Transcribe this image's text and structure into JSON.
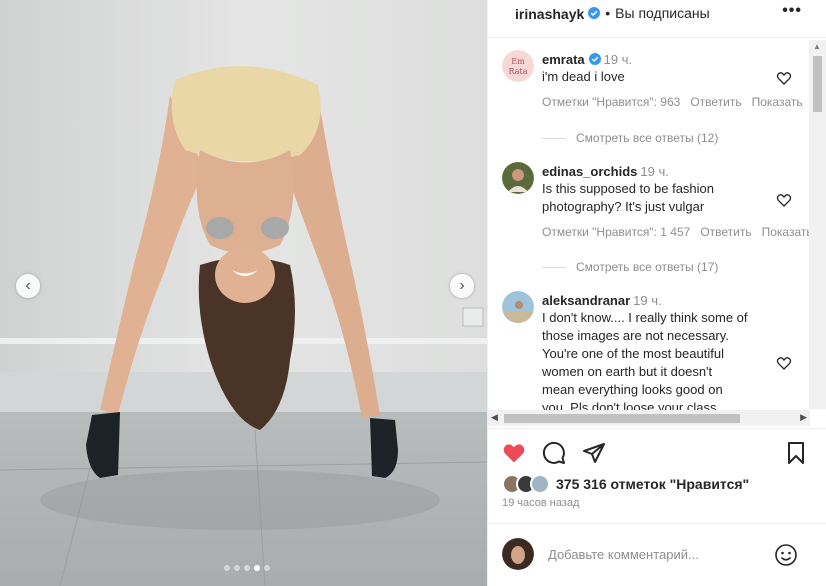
{
  "post": {
    "username": "irinashayk",
    "separator": "•",
    "follow_state": "Вы подписаны",
    "more_label": "•••"
  },
  "media": {
    "prev_icon": "chevron-left-icon",
    "next_icon": "chevron-right-icon",
    "slide_count": 5,
    "active_slide": 4
  },
  "comments": [
    {
      "username": "emrata",
      "verified": true,
      "time": "19 ч.",
      "text": [
        "i'm dead i love"
      ],
      "likes": "Отметки \"Нравится\": 963",
      "reply": "Ответить",
      "show": "Показать",
      "view_replies": "Смотреть все ответы (12)",
      "avatar_text": [
        "Em",
        "Rata"
      ]
    },
    {
      "username": "edinas_orchids",
      "verified": false,
      "time": "19 ч.",
      "text": [
        "Is this supposed to be fashion",
        "photography? It's just vulgar"
      ],
      "likes": "Отметки \"Нравится\": 1 457",
      "reply": "Ответить",
      "show": "Показать",
      "view_replies": "Смотреть все ответы (17)"
    },
    {
      "username": "aleksandranar",
      "verified": false,
      "time": "19 ч.",
      "text": [
        "I don't know.... I really think some of",
        "those images are not necessary.",
        "You're one of the most beautiful",
        "women on earth but it doesn't",
        "mean everything looks good on",
        "you. Pls don't loose your class"
      ]
    }
  ],
  "actions": {
    "like_icon": "heart-filled-icon",
    "comment_icon": "comment-icon",
    "share_icon": "share-icon",
    "save_icon": "bookmark-icon"
  },
  "likes_text": "375 316 отметок \"Нравится\"",
  "time_ago": "19 часов назад",
  "add_comment_placeholder": "Добавьте комментарий...",
  "colors": {
    "like_red": "#ed4956",
    "verified_blue": "#3897f0",
    "muted": "#8e8e8e"
  }
}
